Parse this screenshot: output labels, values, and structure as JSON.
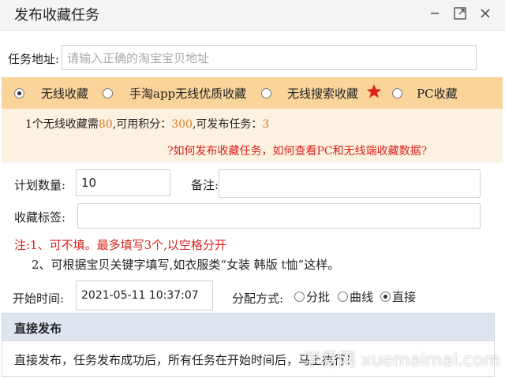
{
  "window": {
    "title": "发布收藏任务",
    "icons": [
      "minimize-icon",
      "maximize-icon",
      "close-icon"
    ]
  },
  "task_address": {
    "label": "任务地址:",
    "placeholder": "请输入正确的淘宝宝贝地址"
  },
  "task_types": [
    {
      "label": "无线收藏",
      "selected": true
    },
    {
      "label": "手淘app无线优质收藏",
      "selected": false
    },
    {
      "label": "无线搜索收藏",
      "selected": false
    },
    {
      "label": "PC收藏",
      "selected": false
    }
  ],
  "info": {
    "line1_a": "1个无线收藏需",
    "cost": "80",
    "line1_b": ",可用积分：",
    "points": "300",
    "line1_c": ",可发布任务：",
    "tasks": "3",
    "help_link": "?如何发布收藏任务，如何查看PC和无线端收藏数据?"
  },
  "plan": {
    "quantity_label": "计划数量:",
    "quantity_value": "10",
    "remark_label": "备注:"
  },
  "tags": {
    "label": "收藏标签:"
  },
  "notes": {
    "note1": "注:1、可不填。最多填写3个,以空格分开",
    "note2": "2、可根据宝贝关键字填写,如衣服类“女装 韩版 t恤”这样。"
  },
  "schedule": {
    "start_label": "开始时间:",
    "start_value": "2021-05-11 10:37:07",
    "dist_label": "分配方式:",
    "options": [
      {
        "label": "分批",
        "selected": false
      },
      {
        "label": "曲线",
        "selected": false
      },
      {
        "label": "直接",
        "selected": true
      }
    ]
  },
  "panel": {
    "header": "直接发布",
    "body": "直接发布，任务发布成功后，所有任务在开始时间后，马上执行！"
  },
  "watermark": "学易网 xuemaimai.com",
  "colors": {
    "orange_bar": "#fbd49c",
    "info_bg": "#fdf1e1",
    "red": "#d9211c",
    "number": "#e07b1a",
    "panel_head": "#dde5ee"
  }
}
